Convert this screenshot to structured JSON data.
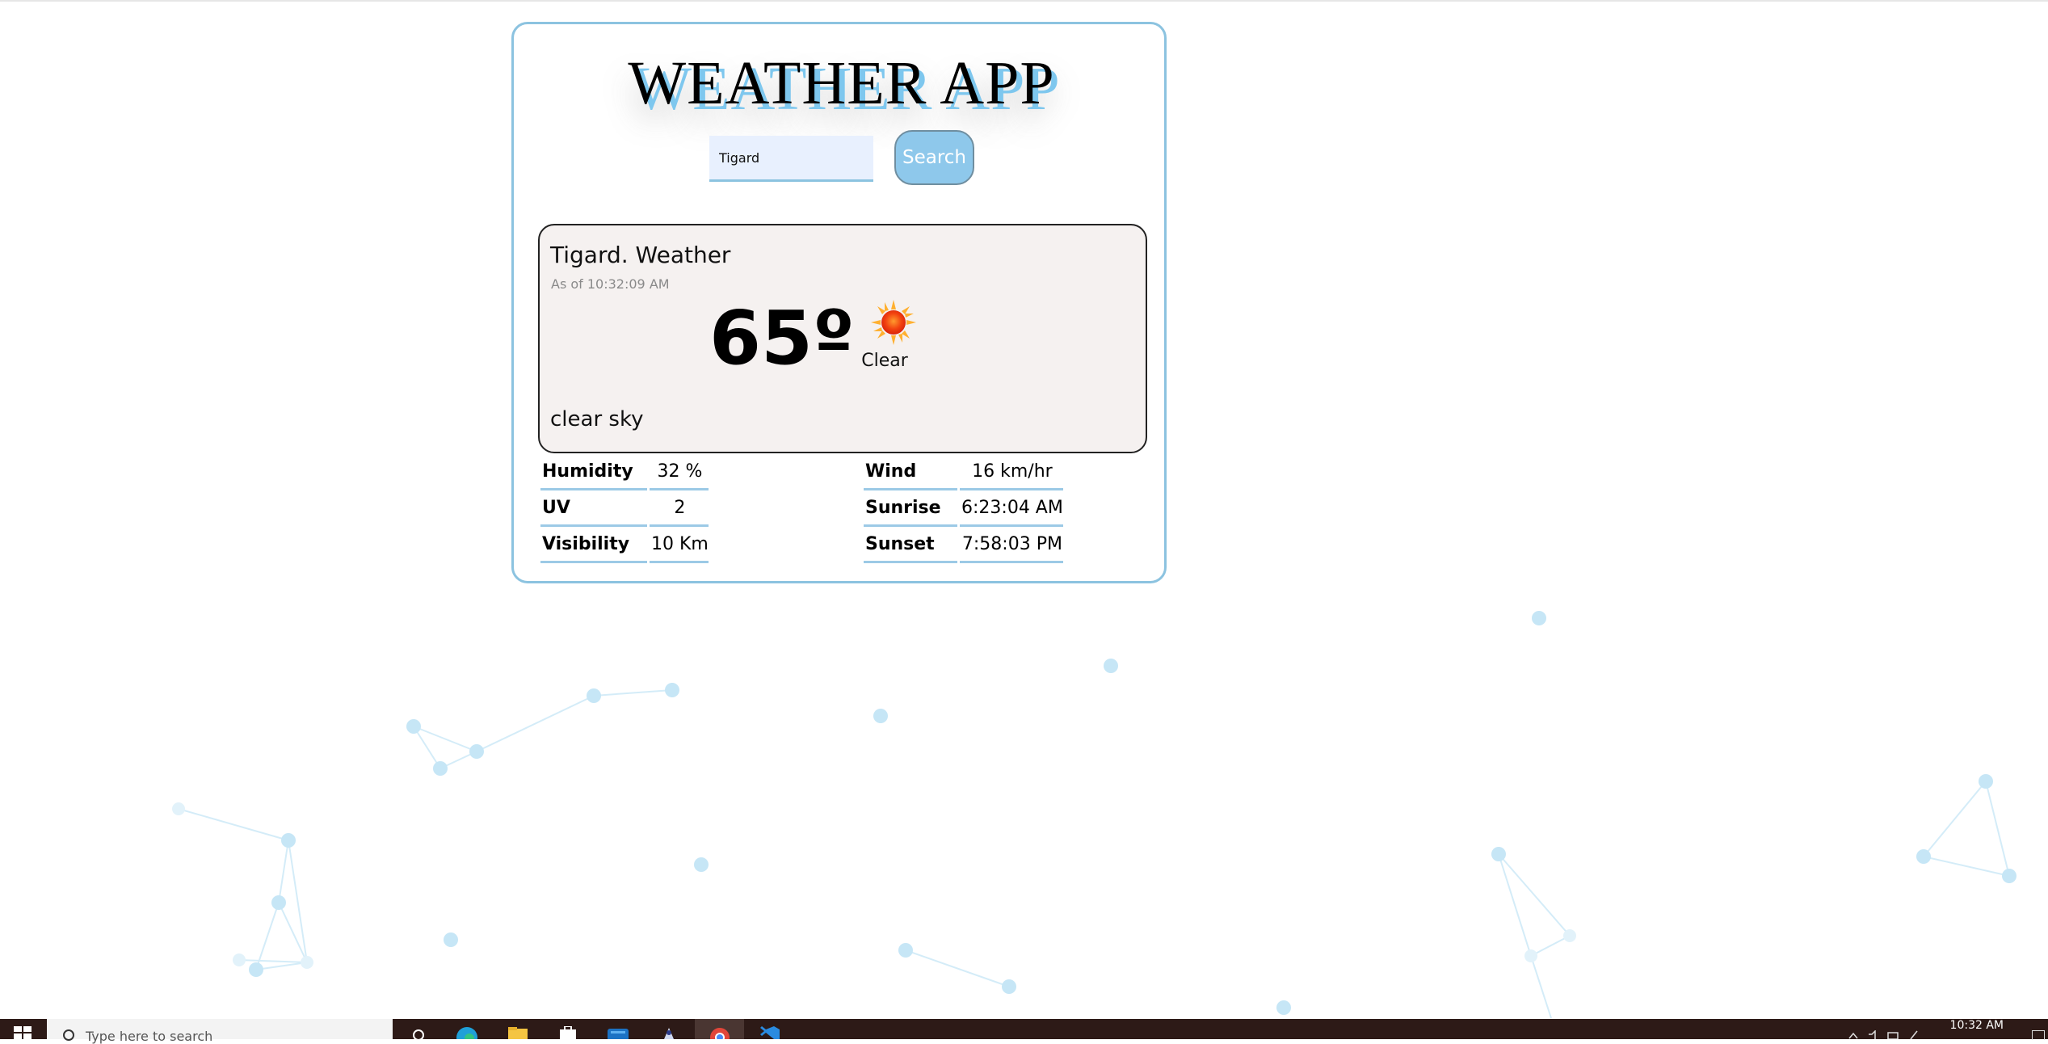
{
  "app": {
    "title": "WEATHER APP",
    "search": {
      "value": "Tigard",
      "placeholder": ""
    },
    "search_button_label": "Search"
  },
  "weather": {
    "city_heading": "Tigard. Weather",
    "as_of": "As of 10:32:09 AM",
    "temperature": "65º",
    "condition": "Clear",
    "condition_icon": "sun-icon",
    "description": "clear sky"
  },
  "stats_left": [
    {
      "label": "Humidity",
      "value": "32 %"
    },
    {
      "label": "UV",
      "value": "2"
    },
    {
      "label": "Visibility",
      "value": "10 Km"
    }
  ],
  "stats_right": [
    {
      "label": "Wind",
      "value": "16 km/hr"
    },
    {
      "label": "Sunrise",
      "value": "6:23:04 AM"
    },
    {
      "label": "Sunset",
      "value": "7:58:03 PM"
    }
  ],
  "taskbar": {
    "search_placeholder": "Type here to search",
    "clock": "10:32 AM",
    "apps": [
      "search-icon",
      "edge-icon",
      "file-explorer-icon",
      "store-icon",
      "mail-icon",
      "app-icon",
      "chrome-icon",
      "vscode-icon"
    ]
  },
  "colors": {
    "accent": "#8cc3e0",
    "button": "#8ec8eb",
    "panel": "#f5f1f0",
    "network": "#bfe3f5",
    "taskbar": "#2d1a17"
  }
}
